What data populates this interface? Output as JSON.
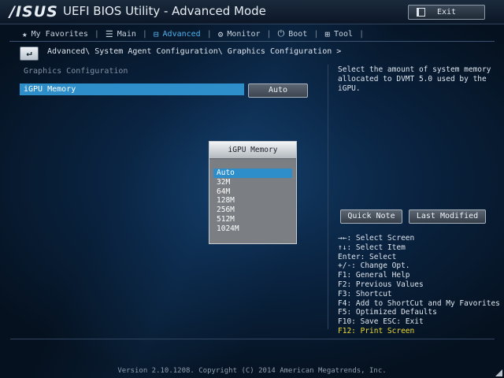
{
  "header": {
    "logo": "/ISUS",
    "title": "UEFI BIOS Utility - Advanced Mode",
    "exit_label": "Exit"
  },
  "tabs": [
    {
      "icon": "star-icon",
      "label": "My Favorites",
      "active": false
    },
    {
      "icon": "list-icon",
      "label": "Main",
      "active": false
    },
    {
      "icon": "advanced-icon",
      "label": "Advanced",
      "active": true
    },
    {
      "icon": "monitor-icon",
      "label": "Monitor",
      "active": false
    },
    {
      "icon": "power-icon",
      "label": "Boot",
      "active": false
    },
    {
      "icon": "toolbox-icon",
      "label": "Tool",
      "active": false
    }
  ],
  "breadcrumb": "Advanced\\ System Agent Configuration\\ Graphics Configuration >",
  "section_title": "Graphics Configuration",
  "setting": {
    "label": "iGPU Memory",
    "value": "Auto"
  },
  "help_text": "Select the amount of system memory allocated to DVMT 5.0 used by the iGPU.",
  "buttons": {
    "quick_note": "Quick Note",
    "last_modified": "Last Modified"
  },
  "keys": [
    "→←: Select Screen",
    "↑↓: Select Item",
    "Enter: Select",
    "+/-: Change Opt.",
    "F1: General Help",
    "F2: Previous Values",
    "F3: Shortcut",
    "F4: Add to ShortCut and My Favorites",
    "F5: Optimized Defaults",
    "F10: Save  ESC: Exit",
    "F12: Print Screen"
  ],
  "popup": {
    "title": "iGPU Memory",
    "options": [
      "Auto",
      "32M",
      "64M",
      "128M",
      "256M",
      "512M",
      "1024M"
    ],
    "selected": "Auto"
  },
  "footer": "Version 2.10.1208. Copyright (C) 2014 American Megatrends, Inc.",
  "colors": {
    "accent": "#2d8ec9",
    "active_tab": "#4fb2ee",
    "highlight_key": "#f0dc30"
  }
}
